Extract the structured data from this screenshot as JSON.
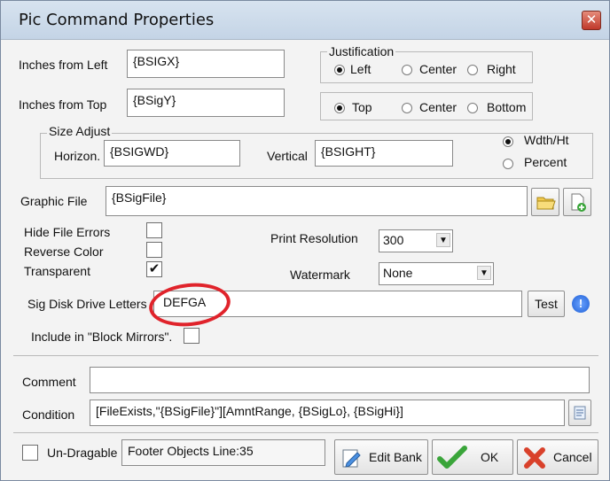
{
  "window": {
    "title": "Pic Command Properties",
    "close_glyph": "✕"
  },
  "position": {
    "left_label": "Inches from Left",
    "left_value": "{BSIGX}",
    "top_label": "Inches from Top",
    "top_value": "{BSigY}"
  },
  "justification": {
    "group_label": "Justification",
    "horizontal": [
      "Left",
      "Center",
      "Right"
    ],
    "vertical": [
      "Top",
      "Center",
      "Bottom"
    ]
  },
  "size_adjust": {
    "group_label": "Size Adjust",
    "horizon_label": "Horizon.",
    "horizon_value": "{BSIGWD}",
    "vertical_label": "Vertical",
    "vertical_value": "{BSIGHT}",
    "mode_options": [
      "Wdth/Ht",
      "Percent"
    ]
  },
  "graphic_file": {
    "label": "Graphic File",
    "value": "{BSigFile}"
  },
  "options": {
    "hide_file_errors": "Hide File Errors",
    "reverse_color": "Reverse Color",
    "transparent": "Transparent",
    "transparent_mark": "✔"
  },
  "print_resolution": {
    "label": "Print Resolution",
    "value": "300"
  },
  "watermark": {
    "label": "Watermark",
    "value": "None"
  },
  "sig_disk": {
    "label": "Sig Disk Drive Letters",
    "value": "DEFGA",
    "test_label": "Test",
    "info_glyph": "!"
  },
  "block_mirrors": {
    "label": "Include in \"Block Mirrors\"."
  },
  "comment": {
    "label": "Comment",
    "value": ""
  },
  "condition": {
    "label": "Condition",
    "value": "[FileExists,\"{BSigFile}\"][AmntRange, {BSigLo}, {BSigHi}]"
  },
  "footer": {
    "undragable_label": "Un-Dragable",
    "status_text": "Footer Objects  Line:35",
    "edit_bank_label": "Edit Bank",
    "ok_label": "OK",
    "cancel_label": "Cancel"
  },
  "colors": {
    "accent_circle": "#e0232b",
    "ok_check": "#3aa53a",
    "cancel_x": "#d9412b"
  }
}
